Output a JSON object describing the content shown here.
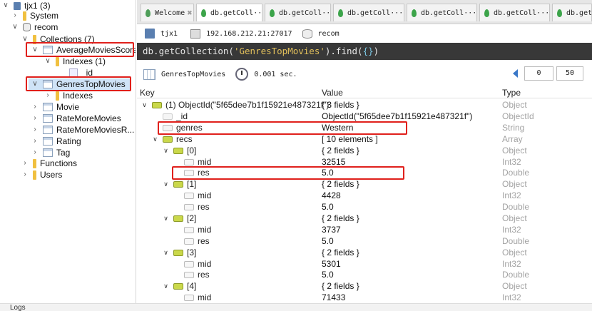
{
  "tree": {
    "server": "tjx1 (3)",
    "system": "System",
    "db": "recom",
    "collections": "Collections (7)",
    "c1": "AverageMoviesScore",
    "indexes1": "Indexes (1)",
    "idx_id": "_id",
    "c2": "GenresTopMovies",
    "indexes2": "Indexes",
    "c3": "Movie",
    "c4": "RateMoreMovies",
    "c5": "RateMoreMoviesR...",
    "c6": "Rating",
    "c7": "Tag",
    "functions": "Functions",
    "users": "Users"
  },
  "tabs": [
    {
      "label": "Welcome"
    },
    {
      "label": "db.getColl···"
    },
    {
      "label": "db.getColl···"
    },
    {
      "label": "db.getColl···"
    },
    {
      "label": "db.getColl···"
    },
    {
      "label": "db.getColl···"
    },
    {
      "label": "db.getCo"
    }
  ],
  "conn": {
    "server": "tjx1",
    "address": "192.168.212.21:27017",
    "db": "recom"
  },
  "query": {
    "prefix": "db.getCollection(",
    "name": "'GenresTopMovies'",
    "suffix": ").find(",
    "braces": "{}",
    "end": ")"
  },
  "result": {
    "collection": "GenresTopMovies",
    "time": "0.001 sec.",
    "skip": "0",
    "limit": "50"
  },
  "grid": {
    "headers": {
      "key": "Key",
      "value": "Value",
      "type": "Type"
    },
    "rows": [
      {
        "k": "(1) ObjectId(\"5f65dee7b1f15921e487321f\")",
        "v": "{ 3 fields }",
        "t": "Object"
      },
      {
        "k": "_id",
        "v": "ObjectId(\"5f65dee7b1f15921e487321f\")",
        "t": "ObjectId"
      },
      {
        "k": "genres",
        "v": "Western",
        "t": "String"
      },
      {
        "k": "recs",
        "v": "[ 10 elements ]",
        "t": "Array"
      },
      {
        "k": "[0]",
        "v": "{ 2 fields }",
        "t": "Object"
      },
      {
        "k": "mid",
        "v": "32515",
        "t": "Int32"
      },
      {
        "k": "res",
        "v": "5.0",
        "t": "Double"
      },
      {
        "k": "[1]",
        "v": "{ 2 fields }",
        "t": "Object"
      },
      {
        "k": "mid",
        "v": "4428",
        "t": "Int32"
      },
      {
        "k": "res",
        "v": "5.0",
        "t": "Double"
      },
      {
        "k": "[2]",
        "v": "{ 2 fields }",
        "t": "Object"
      },
      {
        "k": "mid",
        "v": "3737",
        "t": "Int32"
      },
      {
        "k": "res",
        "v": "5.0",
        "t": "Double"
      },
      {
        "k": "[3]",
        "v": "{ 2 fields }",
        "t": "Object"
      },
      {
        "k": "mid",
        "v": "5301",
        "t": "Int32"
      },
      {
        "k": "res",
        "v": "5.0",
        "t": "Double"
      },
      {
        "k": "[4]",
        "v": "{ 2 fields }",
        "t": "Object"
      },
      {
        "k": "mid",
        "v": "71433",
        "t": "Int32"
      }
    ]
  },
  "logs": "Logs"
}
